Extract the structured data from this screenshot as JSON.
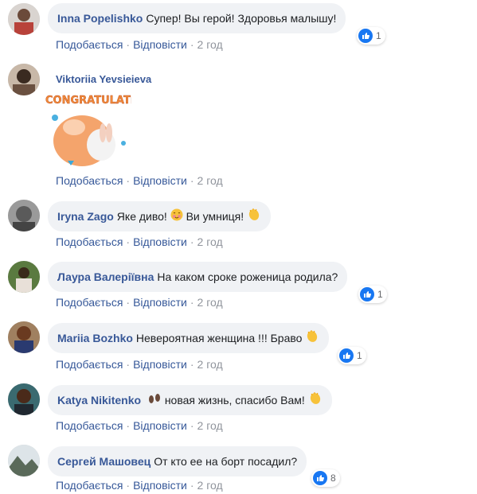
{
  "comments": [
    {
      "author": "Inna Popelishko",
      "text": "Супер! Вы герой! Здоровья малышу!",
      "like": "Подобається",
      "reply": "Відповісти",
      "time": "2 год",
      "reactions": "1"
    },
    {
      "author": "Viktoriia Yevsieieva",
      "sticker": "CONGRATULATIONS",
      "like": "Подобається",
      "reply": "Відповісти",
      "time": "2 год"
    },
    {
      "author": "Iryna Zago",
      "text_a": "Яке диво!",
      "text_b": "Ви умниця!",
      "like": "Подобається",
      "reply": "Відповісти",
      "time": "2 год"
    },
    {
      "author": "Лаура Валеріївна",
      "text": "На каком сроке роженица родила?",
      "like": "Подобається",
      "reply": "Відповісти",
      "time": "2 год",
      "reactions": "1"
    },
    {
      "author": "Mariia Bozhko",
      "text": "Невероятная женщина !!! Браво",
      "like": "Подобається",
      "reply": "Відповісти",
      "time": "2 год",
      "reactions": "1"
    },
    {
      "author": "Katya Nikitenko",
      "text": "новая жизнь, спасибо Вам!",
      "like": "Подобається",
      "reply": "Відповісти",
      "time": "2 год"
    },
    {
      "author": "Сергей Машовец",
      "text": "От кто ее на борт посадил?",
      "like": "Подобається",
      "reply": "Відповісти",
      "time": "2 год",
      "reactions": "8"
    }
  ],
  "colors": {
    "author": "#385898",
    "bubble": "#f0f2f5",
    "like_blue": "#1877f2",
    "meta": "#90949c"
  },
  "icons": [
    "like-reaction-icon",
    "clapping-hands-icon",
    "footprints-icon",
    "blushing-face-icon"
  ]
}
